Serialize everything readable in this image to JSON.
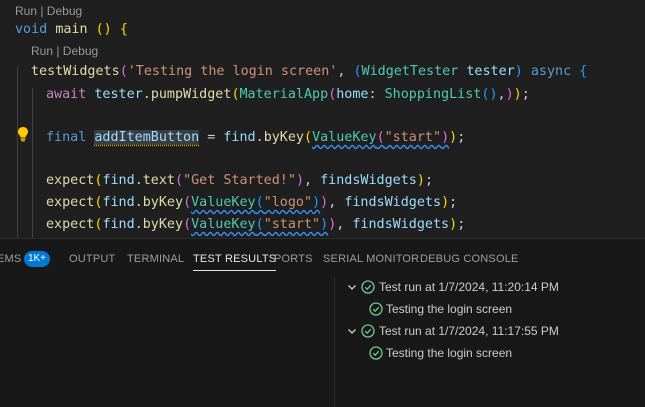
{
  "editor": {
    "codelens": [
      "Run | Debug",
      "Run | Debug"
    ],
    "code": {
      "main_decl": [
        "void",
        " ",
        "main",
        " ",
        "()",
        " ",
        "{"
      ],
      "test_call": [
        "testWidgets",
        "(",
        "'Testing the login screen'",
        ", ",
        "(",
        "WidgetTester",
        " ",
        "tester",
        ")",
        " ",
        "async",
        " ",
        "{"
      ],
      "pump": [
        "await",
        " ",
        "tester",
        ".",
        "pumpWidget",
        "(",
        "MaterialApp",
        "(",
        "home",
        ": ",
        "ShoppingList",
        "(",
        ")",
        ",",
        ")",
        ")",
        ";"
      ],
      "final": [
        "final",
        " ",
        "addItemButton",
        " = ",
        "find",
        ".",
        "byKey",
        "(",
        "ValueKey",
        "(",
        "\"start\"",
        ")",
        ")",
        ";"
      ],
      "expect1": [
        "expect",
        "(",
        "find",
        ".",
        "text",
        "(",
        "\"Get Started!\"",
        ")",
        ", ",
        "findsWidgets",
        ")",
        ";"
      ],
      "expect2": [
        "expect",
        "(",
        "find",
        ".",
        "byKey",
        "(",
        "ValueKey",
        "(",
        "\"logo\"",
        ")",
        ")",
        ", ",
        "findsWidgets",
        ")",
        ";"
      ],
      "expect3": [
        "expect",
        "(",
        "find",
        ".",
        "byKey",
        "(",
        "ValueKey",
        "(",
        "\"start\"",
        ")",
        ")",
        ", ",
        "findsWidgets",
        ")",
        ";"
      ]
    }
  },
  "panel": {
    "tabs": {
      "problems_partial": "EMS",
      "problems_badge": "1K+",
      "output": "OUTPUT",
      "terminal": "TERMINAL",
      "test_results": "TEST RESULTS",
      "ports": "PORTS",
      "serial_monitor": "SERIAL MONITOR",
      "debug_console": "DEBUG CONSOLE"
    },
    "active_tab": "TEST RESULTS",
    "results": [
      {
        "label": "Test run at 1/7/2024, 11:20:14 PM",
        "status": "passed",
        "children": [
          {
            "label": "Testing the login screen",
            "status": "passed"
          }
        ]
      },
      {
        "label": "Test run at 1/7/2024, 11:17:55 PM",
        "status": "passed",
        "children": [
          {
            "label": "Testing the login screen",
            "status": "passed"
          }
        ]
      }
    ]
  },
  "colors": {
    "editor_bg": "#1f1f1f",
    "panel_bg": "#181818",
    "keyword": "#569cd6",
    "function": "#dcdcaa",
    "class": "#4ec9b0",
    "string": "#ce9178",
    "variable": "#9cdcfe",
    "control": "#c586c0",
    "pass_green": "#73c991",
    "badge_blue": "#0078d4"
  }
}
